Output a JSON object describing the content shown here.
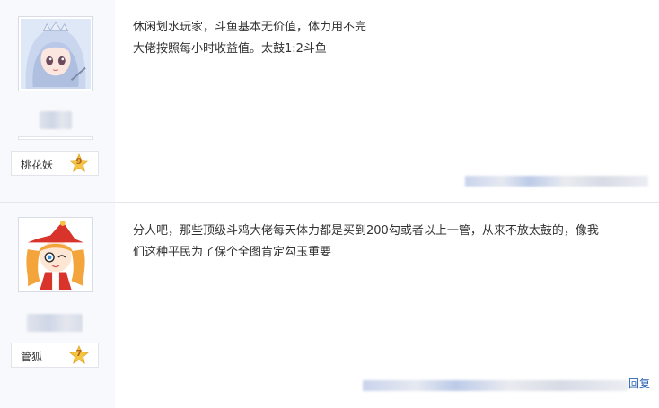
{
  "posts": [
    {
      "level_name": "桃花妖",
      "level": "9",
      "lines": [
        "休闲划水玩家，斗鱼基本无价值，体力用不完",
        "大佬按照每小时收益值。太鼓1:2斗鱼"
      ],
      "reply_label": ""
    },
    {
      "level_name": "管狐",
      "level": "7",
      "lines": [
        "分人吧，那些顶级斗鸡大佬每天体力都是买到200勾或者以上一管，从来不放太鼓的，像我",
        "们这种平民为了保个全图肯定勾玉重要"
      ],
      "reply_label": "回复"
    }
  ],
  "colors": {
    "sidebar_bg": "#f8f9fc",
    "text": "#333333",
    "link": "#2d64b3",
    "star": "#f5c443"
  }
}
